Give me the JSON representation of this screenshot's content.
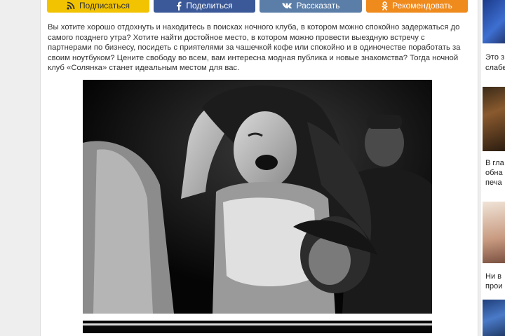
{
  "share": {
    "subscribe_label": "Подписаться",
    "facebook_label": "Поделиться",
    "vk_label": "Рассказать",
    "ok_label": "Рекомендовать"
  },
  "article": {
    "intro": "Вы хотите хорошо отдохнуть и находитесь в поисках ночного клуба, в котором можно спокойно задержаться до самого позднего утра? Хотите найти достойное место, в котором можно провести выездную встречу с партнерами по бизнесу, посидеть с приятелями за чашечкой кофе или спокойно и в одиночестве поработать за своим ноутбуком? Цените свободу во всем, вам интересна модная публика и новые знакомства? Тогда ночной клуб «Солянка» станет идеальным местом для вас."
  },
  "sidebar": {
    "items": [
      {
        "line1": "Это з",
        "line2": "слабе"
      },
      {
        "line1": "В гла",
        "line2": "обна",
        "line3": "печа"
      },
      {
        "line1": "Ни в",
        "line2": "прои"
      }
    ]
  },
  "icons": {
    "subscribe": "rss-icon",
    "facebook": "facebook-icon",
    "vk": "vk-icon",
    "ok": "odnoklassniki-icon"
  }
}
